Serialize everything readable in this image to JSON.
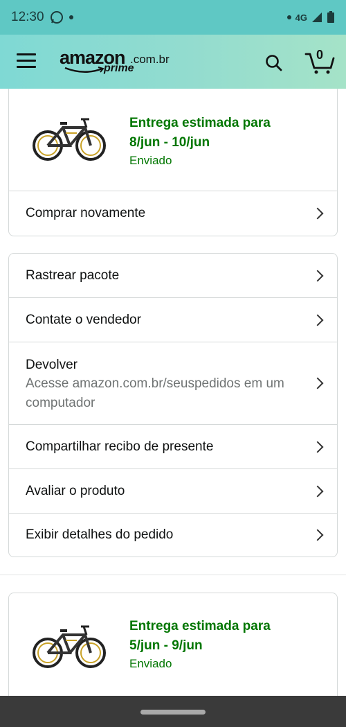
{
  "status": {
    "time": "12:30",
    "network": "4G"
  },
  "header": {
    "logo_main": "amazon",
    "logo_domain": ".com.br",
    "logo_prime": "prime",
    "cart_count": "0",
    "icons": [
      "menu-icon",
      "search-icon",
      "cart-icon"
    ]
  },
  "order1": {
    "delivery_line1": "Entrega estimada para",
    "delivery_line2": "8/jun - 10/jun",
    "status": "Enviado",
    "buy_again": "Comprar novamente"
  },
  "actions": {
    "track": "Rastrear pacote",
    "contact": "Contate o vendedor",
    "return_title": "Devolver",
    "return_sub": "Acesse amazon.com.br/seuspedidos em um computador",
    "gift_receipt": "Compartilhar recibo de presente",
    "review": "Avaliar o produto",
    "details": "Exibir detalhes do pedido"
  },
  "order2": {
    "delivery_line1": "Entrega estimada para",
    "delivery_line2": "5/jun - 9/jun",
    "status": "Enviado"
  },
  "colors": {
    "status_bar": "#5fc8c4",
    "header_start": "#7fd9d4",
    "header_end": "#a5e3c8",
    "delivery_green": "#007600",
    "border": "#d5d9d9"
  }
}
